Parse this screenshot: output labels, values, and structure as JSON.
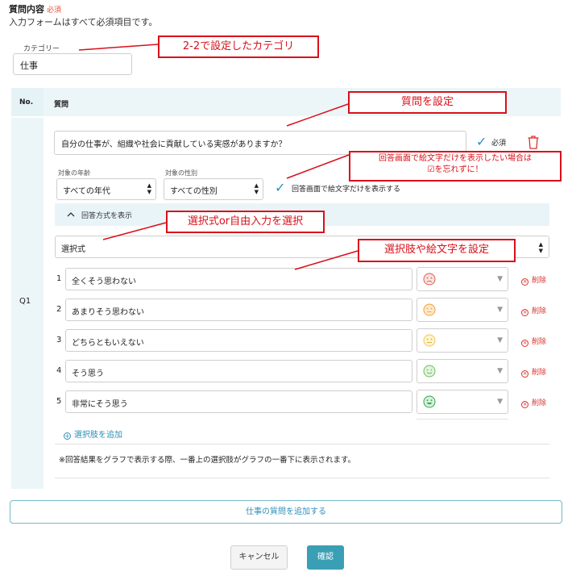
{
  "header": {
    "title": "質問内容",
    "required_tag": "必須",
    "note": "入力フォームはすべて必須項目です。"
  },
  "category": {
    "label": "カテゴリー",
    "value": "仕事"
  },
  "table": {
    "col_no": "No.",
    "col_question": "質問"
  },
  "question": {
    "number": "Q1",
    "text": "自分の仕事が、組織や社会に貢献している実感がありますか？",
    "required_label": "必須",
    "age_label": "対象の年齢",
    "age_value": "すべての年代",
    "gender_label": "対象の性別",
    "gender_value": "すべての性別",
    "emoji_only_label": "回答画面で絵文字だけを表示する",
    "answer_toggle": "回答方式を表示",
    "answer_type": "選択式",
    "choices": [
      {
        "num": "1",
        "text": "全くそう思わない",
        "color": "#e05a4a",
        "delete": "削除"
      },
      {
        "num": "2",
        "text": "あまりそう思わない",
        "color": "#f0a030",
        "delete": "削除"
      },
      {
        "num": "3",
        "text": "どちらともいえない",
        "color": "#f2c84b",
        "delete": "削除"
      },
      {
        "num": "4",
        "text": "そう思う",
        "color": "#6bbf59",
        "delete": "削除"
      },
      {
        "num": "5",
        "text": "非常にそう思う",
        "color": "#2fa84f",
        "delete": "削除"
      }
    ],
    "add_choice": "選択肢を追加",
    "graph_note": "※回答結果をグラフで表示する際、一番上の選択肢がグラフの一番下に表示されます。"
  },
  "add_question_button": "仕事の質問を追加する",
  "cancel_button": "キャンセル",
  "confirm_button": "確認",
  "annotations": {
    "category": "2-2で設定したカテゴリ",
    "question": "質問を設定",
    "emoji_line1": "回答画面で絵文字だけを表示したい場合は",
    "emoji_line2": "☑を忘れずに！",
    "answer_type": "選択式or自由入力を選択",
    "choices": "選択肢や絵文字を設定"
  },
  "colors": {
    "accent": "#2e8fb8",
    "callout": "#d9101a",
    "delete": "#d9322b"
  }
}
